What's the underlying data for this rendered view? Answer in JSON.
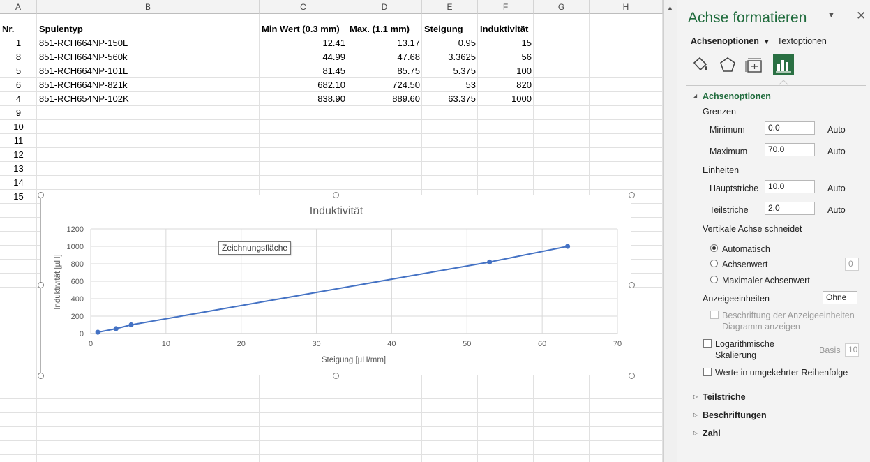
{
  "columns": [
    "A",
    "B",
    "C",
    "D",
    "E",
    "F",
    "G",
    "H"
  ],
  "table": {
    "headers": [
      "Nr.",
      "Spulentyp",
      "Min Wert (0.3 mm)",
      "Max. (1.1 mm)",
      "Steigung",
      "Induktivität"
    ],
    "rows": [
      [
        "1",
        "851-RCH664NP-150L",
        "12.41",
        "13.17",
        "0.95",
        "15"
      ],
      [
        "8",
        "851-RCH664NP-560k",
        "44.99",
        "47.68",
        "3.3625",
        "56"
      ],
      [
        "5",
        "851-RCH664NP-101L",
        "81.45",
        "85.75",
        "5.375",
        "100"
      ],
      [
        "6",
        "851-RCH664NP-821k",
        "682.10",
        "724.50",
        "53",
        "820"
      ],
      [
        "4",
        "851-RCH654NP-102K",
        "838.90",
        "889.60",
        "63.375",
        "1000"
      ]
    ],
    "extra_row_labels": [
      "9",
      "10",
      "11",
      "12",
      "13",
      "14",
      "15"
    ]
  },
  "chart_data": {
    "type": "scatter",
    "title": "Induktivität",
    "xlabel": "Steigung [µH/mm]",
    "ylabel": "Induktivität [µH]",
    "xlim": [
      0,
      70
    ],
    "ylim": [
      0,
      1200
    ],
    "x_ticks": [
      0,
      10,
      20,
      30,
      40,
      50,
      60,
      70
    ],
    "y_ticks": [
      0,
      200,
      400,
      600,
      800,
      1000,
      1200
    ],
    "grid": true,
    "line": true,
    "series_color": "#4472c4",
    "series": [
      {
        "x": [
          0.95,
          3.3625,
          5.375,
          53,
          63.375
        ],
        "y": [
          15,
          56,
          100,
          820,
          1000
        ]
      }
    ]
  },
  "tooltip": "Zeichnungsfläche",
  "pane": {
    "title": "Achse formatieren",
    "tab_axis": "Achsenoptionen",
    "tab_text": "Textoptionen",
    "icons": [
      "fill-line-icon",
      "effects-icon",
      "size-properties-icon",
      "axis-options-icon"
    ],
    "section_axis": "Achsenoptionen",
    "bounds_label": "Grenzen",
    "minimum_label": "Minimum",
    "minimum_value": "0.0",
    "maximum_label": "Maximum",
    "maximum_value": "70.0",
    "auto": "Auto",
    "units_label": "Einheiten",
    "major_label": "Hauptstriche",
    "major_value": "10.0",
    "minor_label": "Teilstriche",
    "minor_value": "2.0",
    "crosses_label": "Vertikale Achse schneidet",
    "radio_auto": "Automatisch",
    "radio_value": "Achsenwert",
    "radio_value_field": "0",
    "radio_max": "Maximaler Achsenwert",
    "display_units_label": "Anzeigeeinheiten",
    "display_units_value": "Ohne",
    "show_units_label_1": "Beschriftung der Anzeigeeinheiten im",
    "show_units_label_2": "Diagramm anzeigen",
    "log_label_1": "Logarithmische",
    "log_label_2": "Skalierung",
    "base_label": "Basis",
    "base_value": "10",
    "reverse_label": "Werte in umgekehrter Reihenfolge",
    "section_ticks": "Teilstriche",
    "section_labels": "Beschriftungen",
    "section_number": "Zahl"
  },
  "colors": {
    "accent": "#1f6b3c",
    "series": "#4472c4"
  }
}
